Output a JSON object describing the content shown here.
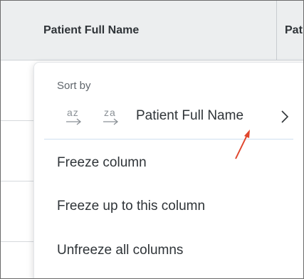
{
  "table": {
    "columns": [
      "Patient Full Name",
      "Pat"
    ]
  },
  "menu": {
    "sort": {
      "label": "Sort by",
      "asc_icon_text": "az",
      "desc_icon_text": "za",
      "field": "Patient Full Name"
    },
    "items": [
      "Freeze column",
      "Freeze up to this column",
      "Unfreeze all columns"
    ]
  },
  "colors": {
    "header_bg": "#eceeef",
    "accent_divider": "#cfe0f0",
    "annotation_arrow": "#e0462d"
  }
}
